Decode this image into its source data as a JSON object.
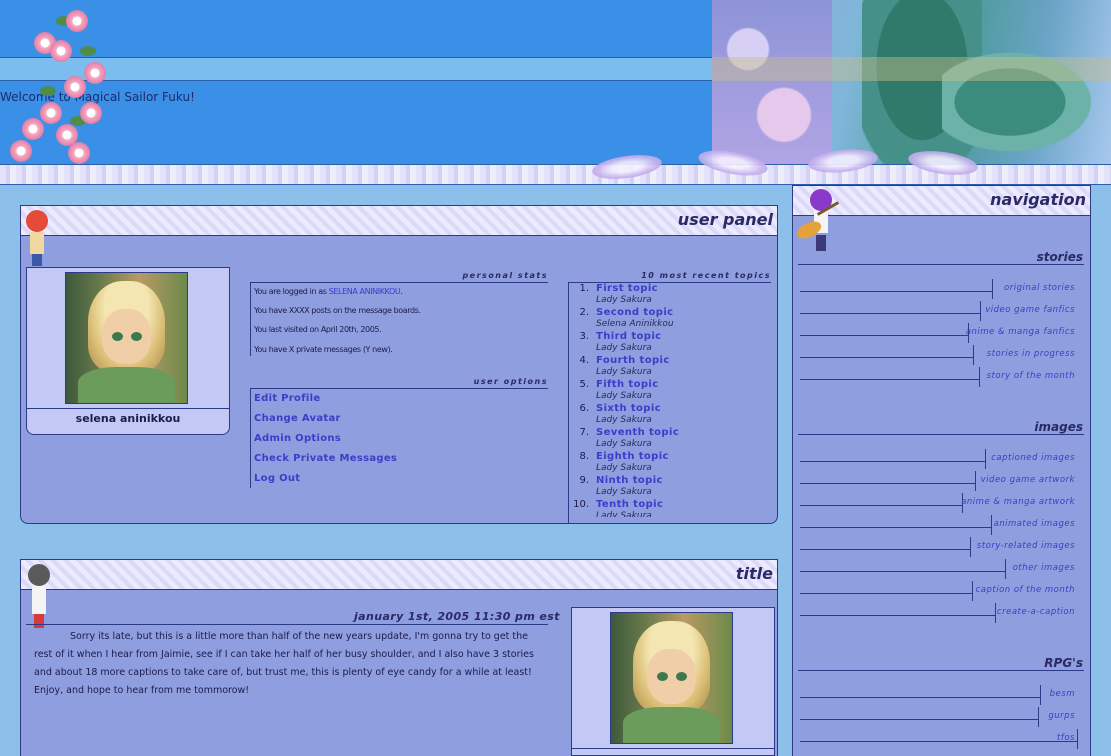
{
  "header": {
    "welcome": "Welcome to Magical Sailor Fuku!"
  },
  "user_panel": {
    "title": "user panel",
    "username": "selena aninikkou",
    "personal_stats_label": "personal stats",
    "stats": {
      "logged_in_prefix": "You are logged in as ",
      "logged_in_name": "SELENA ANINIKKOU",
      "logged_in_suffix": ".",
      "posts": "You have XXXX posts on the message boards.",
      "last_visit": "You last visited on April 20th, 2005.",
      "pm": "You have X private messages (Y new)."
    },
    "user_options_label": "user options",
    "options": [
      "Edit Profile",
      "Change Avatar",
      "Admin Options",
      "Check Private Messages",
      "Log Out"
    ],
    "recent_topics_label": "10 most recent topics",
    "topics": [
      {
        "num": "1.",
        "title": "First topic",
        "author": "Lady Sakura"
      },
      {
        "num": "2.",
        "title": "Second topic",
        "author": "Selena Aninikkou"
      },
      {
        "num": "3.",
        "title": "Third topic",
        "author": "Lady Sakura"
      },
      {
        "num": "4.",
        "title": "Fourth topic",
        "author": "Lady Sakura"
      },
      {
        "num": "5.",
        "title": "Fifth topic",
        "author": "Lady Sakura"
      },
      {
        "num": "6.",
        "title": "Sixth topic",
        "author": "Lady Sakura"
      },
      {
        "num": "7.",
        "title": "Seventh topic",
        "author": "Lady Sakura"
      },
      {
        "num": "8.",
        "title": "Eighth topic",
        "author": "Lady Sakura"
      },
      {
        "num": "9.",
        "title": "Ninth topic",
        "author": "Lady Sakura"
      },
      {
        "num": "10.",
        "title": "Tenth topic",
        "author": "Lady Sakura"
      }
    ]
  },
  "post": {
    "title": "title",
    "date": "january 1st, 2005 11:30 pm est",
    "body": "Sorry its late, but this is a little more than half of the new years update, I'm gonna try to get the rest of it when I hear from Jaimie, see if I can take her half of her busy shoulder, and I also have 3 stories and about 18 more captions to take care of, but trust me, this is plenty of eye candy for a while at least! Enjoy, and hope to hear from me tommorow!"
  },
  "navigation": {
    "title": "navigation",
    "sections": [
      {
        "heading": "stories",
        "items": [
          "original stories",
          "video game fanfics",
          "anime & manga fanfics",
          "stories in progress",
          "story of the month"
        ]
      },
      {
        "heading": "images",
        "items": [
          "captioned images",
          "video game artwork",
          "anime & manga artwork",
          "animated images",
          "story-related images",
          "other images",
          "caption of the month",
          "create-a-caption"
        ]
      },
      {
        "heading": "RPG's",
        "items": [
          "besm",
          "gurps",
          "tfos"
        ]
      }
    ]
  },
  "colors": {
    "background": "#8cc0ea",
    "header_blue": "#3a8fe6",
    "panel": "#8e9ede",
    "link": "#3d3dc8",
    "border": "#2d3a88"
  },
  "icons": [
    "cherry-blossom-icon",
    "anime-sprite-icon",
    "guitar-sprite-icon",
    "avatar-image"
  ]
}
